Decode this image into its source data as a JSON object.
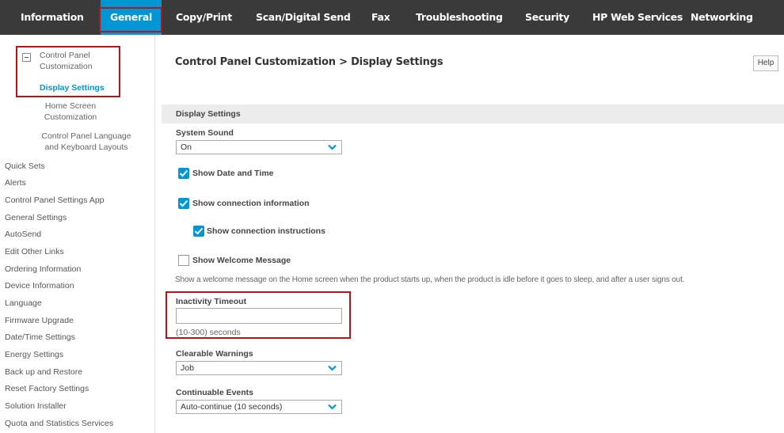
{
  "topnav": {
    "tabs": [
      {
        "label": "Information"
      },
      {
        "label": "General"
      },
      {
        "label": "Copy/Print"
      },
      {
        "label": "Scan/Digital Send"
      },
      {
        "label": "Fax"
      },
      {
        "label": "Troubleshooting"
      },
      {
        "label": "Security"
      },
      {
        "label": "HP Web Services"
      },
      {
        "label": "Networking"
      }
    ],
    "active_tab": "General",
    "active_color": "#0096d6"
  },
  "sidebar": {
    "group_label": "Control Panel Customization",
    "group_label_line1": "Control Panel",
    "group_label_line2": "Customization",
    "sub_items": {
      "display_settings": "Display Settings",
      "home_screen_line1": "Home Screen",
      "home_screen_line2": "Customization",
      "language_line1": "Control Panel Language",
      "language_line2": "and Keyboard Layouts"
    },
    "items": [
      "Quick Sets",
      "Alerts",
      "Control Panel Settings App",
      "General Settings",
      "AutoSend",
      "Edit Other Links",
      "Ordering Information",
      "Device Information",
      "Language",
      "Firmware Upgrade",
      "Date/Time Settings",
      "Energy Settings",
      "Back up and Restore",
      "Reset Factory Settings",
      "Solution Installer",
      "Quota and Statistics Services"
    ]
  },
  "main": {
    "title": "Control Panel Customization > Display Settings",
    "help_label": "Help",
    "section_title": "Display Settings",
    "system_sound": {
      "label": "System Sound",
      "value": "On"
    },
    "checkboxes": {
      "date_time": {
        "label": "Show Date and Time",
        "checked": true
      },
      "connection_info": {
        "label": "Show connection information",
        "checked": true
      },
      "connection_instructions": {
        "label": "Show connection instructions",
        "checked": true
      },
      "welcome": {
        "label": "Show Welcome Message",
        "checked": false
      }
    },
    "welcome_description": "Show a welcome message on the Home screen when the product starts up, when the product is idle before it goes to sleep, and after a user signs out.",
    "inactivity_timeout": {
      "label": "Inactivity Timeout",
      "value": "",
      "hint": "(10-300) seconds"
    },
    "clearable_warnings": {
      "label": "Clearable Warnings",
      "value": "Job"
    },
    "continuable_events": {
      "label": "Continuable Events",
      "value": "Auto-continue (10 seconds)"
    }
  },
  "icons": {
    "dropdown": "chevron-down-icon",
    "checkbox": "checkmark-icon",
    "collapse": "minus-icon"
  },
  "colors": {
    "nav_bg": "#3a3a3a",
    "accent": "#0096d6",
    "highlight_box": "#b0161c",
    "section_bar": "#ececec"
  }
}
